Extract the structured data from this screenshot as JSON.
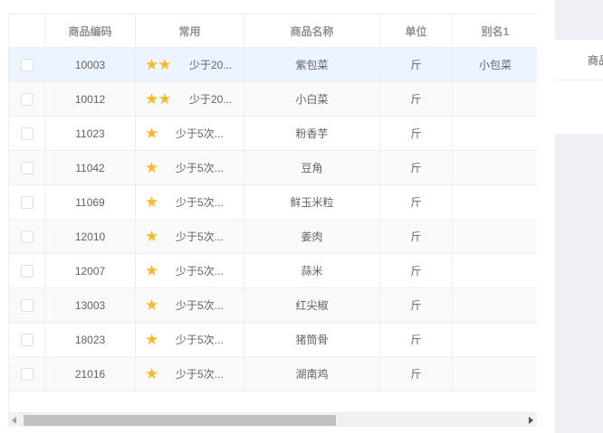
{
  "table": {
    "headers": [
      "商品编码",
      "常用",
      "商品名称",
      "单位",
      "别名1"
    ],
    "rows": [
      {
        "code": "10003",
        "stars": "★★",
        "freq": "少于20...",
        "name": "紫包菜",
        "unit": "斤",
        "alias": "小包菜"
      },
      {
        "code": "10012",
        "stars": "★★",
        "freq": "少于20...",
        "name": "小白菜",
        "unit": "斤",
        "alias": ""
      },
      {
        "code": "11023",
        "stars": "★",
        "freq": "少于5次...",
        "name": "粉香芋",
        "unit": "斤",
        "alias": ""
      },
      {
        "code": "11042",
        "stars": "★",
        "freq": "少于5次...",
        "name": "豆角",
        "unit": "斤",
        "alias": ""
      },
      {
        "code": "11069",
        "stars": "★",
        "freq": "少于5次...",
        "name": "鲜玉米粒",
        "unit": "斤",
        "alias": ""
      },
      {
        "code": "12010",
        "stars": "★",
        "freq": "少于5次...",
        "name": "姜肉",
        "unit": "斤",
        "alias": ""
      },
      {
        "code": "12007",
        "stars": "★",
        "freq": "少于5次...",
        "name": "蒜米",
        "unit": "斤",
        "alias": ""
      },
      {
        "code": "13003",
        "stars": "★",
        "freq": "少于5次...",
        "name": "红尖椒",
        "unit": "斤",
        "alias": ""
      },
      {
        "code": "18023",
        "stars": "★",
        "freq": "少于5次...",
        "name": "猪筒骨",
        "unit": "斤",
        "alias": ""
      },
      {
        "code": "21016",
        "stars": "★",
        "freq": "少于5次...",
        "name": "湖南鸡",
        "unit": "斤",
        "alias": ""
      }
    ],
    "highlighted_row": 0
  },
  "side_panel": {
    "header": "商品"
  },
  "colors": {
    "star": "#f7ba2a",
    "row_highlight": "#ecf5ff",
    "border": "#ebeef5",
    "side_bg": "#eef0f5"
  }
}
